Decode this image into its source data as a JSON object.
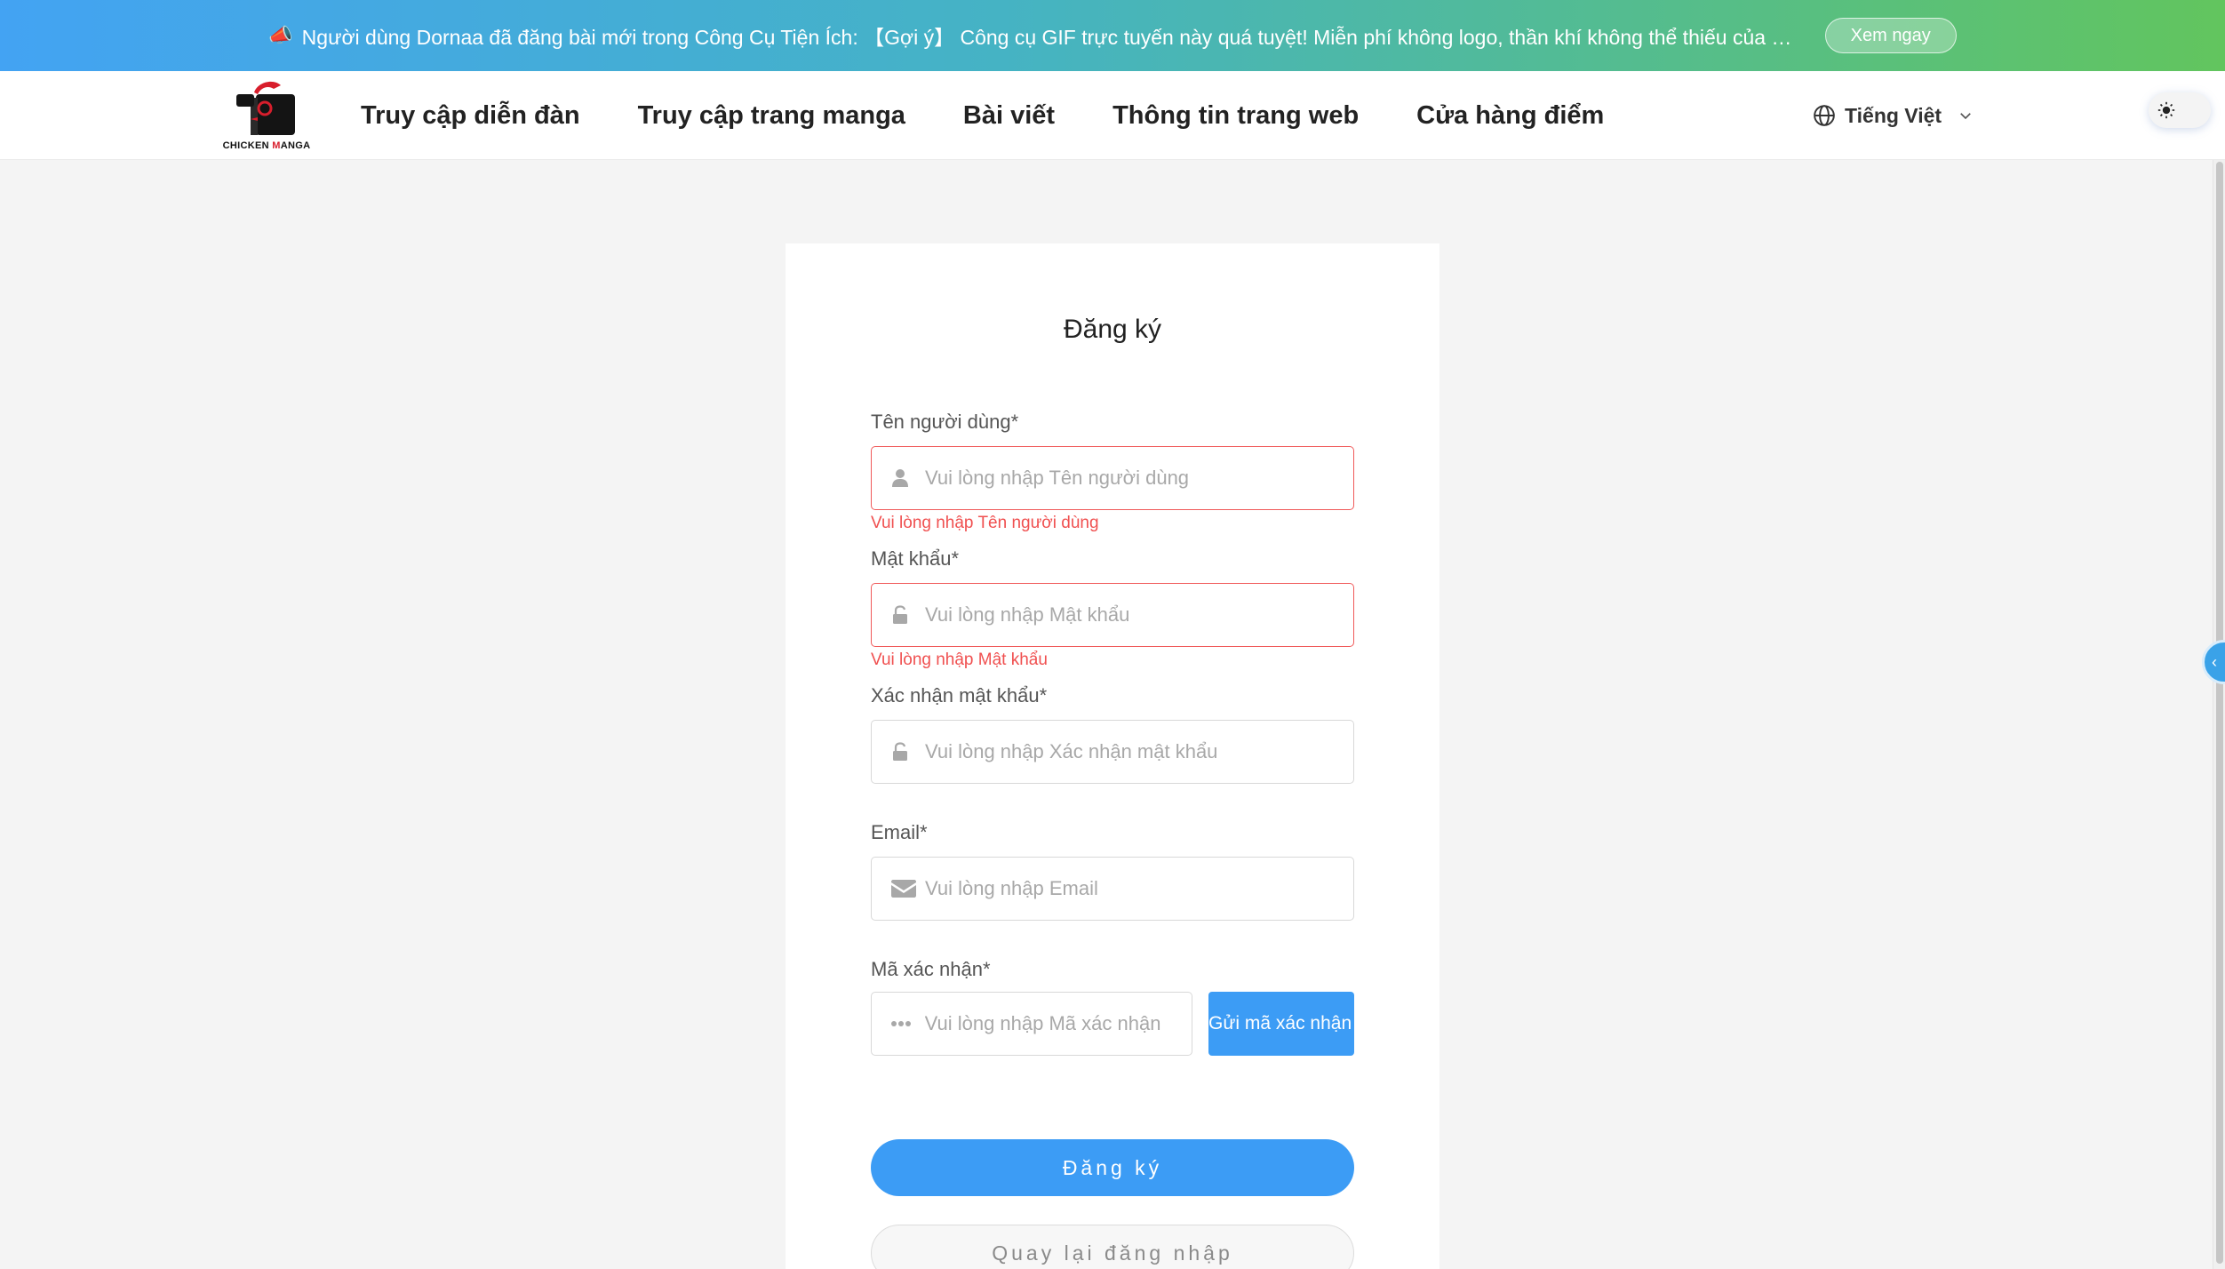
{
  "banner": {
    "icon": "megaphone-icon",
    "text": "Người dùng Dornaa đã đăng bài mới trong Công Cụ Tiện Ích: 【Gợi ý】 Công cụ GIF trực tuyến này quá tuyệt! Miễn phí không logo, thần khí không thể thiếu của b...",
    "button_label": "Xem ngay"
  },
  "header": {
    "logo_text_a": "CHICKEN ",
    "logo_text_m": "M",
    "logo_text_b": "ANGA",
    "nav": [
      "Truy cập diễn đàn",
      "Truy cập trang manga",
      "Bài viết",
      "Thông tin trang web",
      "Cửa hàng điểm"
    ],
    "language": "Tiếng Việt"
  },
  "form": {
    "title": "Đăng ký",
    "username": {
      "label": "Tên người dùng*",
      "placeholder": "Vui lòng nhập Tên người dùng",
      "error": "Vui lòng nhập Tên người dùng"
    },
    "password": {
      "label": "Mật khẩu*",
      "placeholder": "Vui lòng nhập Mật khẩu",
      "error": "Vui lòng nhập Mật khẩu"
    },
    "confirm": {
      "label": "Xác nhận mật khẩu*",
      "placeholder": "Vui lòng nhập Xác nhận mật khẩu"
    },
    "email": {
      "label": "Email*",
      "placeholder": "Vui lòng nhập Email"
    },
    "code": {
      "label": "Mã xác nhận*",
      "placeholder": "Vui lòng nhập Mã xác nhận",
      "send_label": "Gửi mã xác nhận"
    },
    "submit_label": "Đăng ký",
    "back_label": "Quay lại đăng nhập"
  },
  "colors": {
    "accent": "#3c9cf5",
    "error": "#f05a5a",
    "banner_start": "#43a3f3",
    "banner_end": "#62c55e"
  }
}
